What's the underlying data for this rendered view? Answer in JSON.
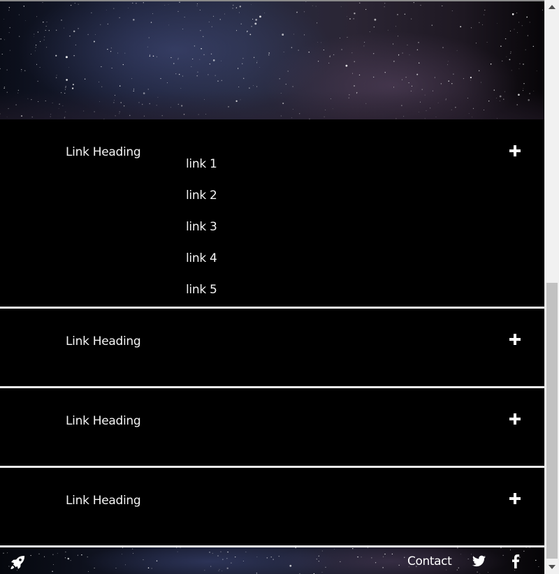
{
  "accordion": {
    "sections": [
      {
        "heading": "Link Heading",
        "expanded": true,
        "links": [
          "link 1",
          "link 2",
          "link 3",
          "link 4",
          "link 5"
        ]
      },
      {
        "heading": "Link Heading",
        "expanded": false
      },
      {
        "heading": "Link Heading",
        "expanded": false
      },
      {
        "heading": "Link Heading",
        "expanded": false
      }
    ],
    "toggle_icon": "plus-icon"
  },
  "footer": {
    "contact_label": "Contact",
    "icons": [
      "rocket-icon",
      "twitter-icon",
      "facebook-icon"
    ]
  },
  "colors": {
    "background": "#000000",
    "text": "#ffffff",
    "divider": "#f2f2f2"
  }
}
